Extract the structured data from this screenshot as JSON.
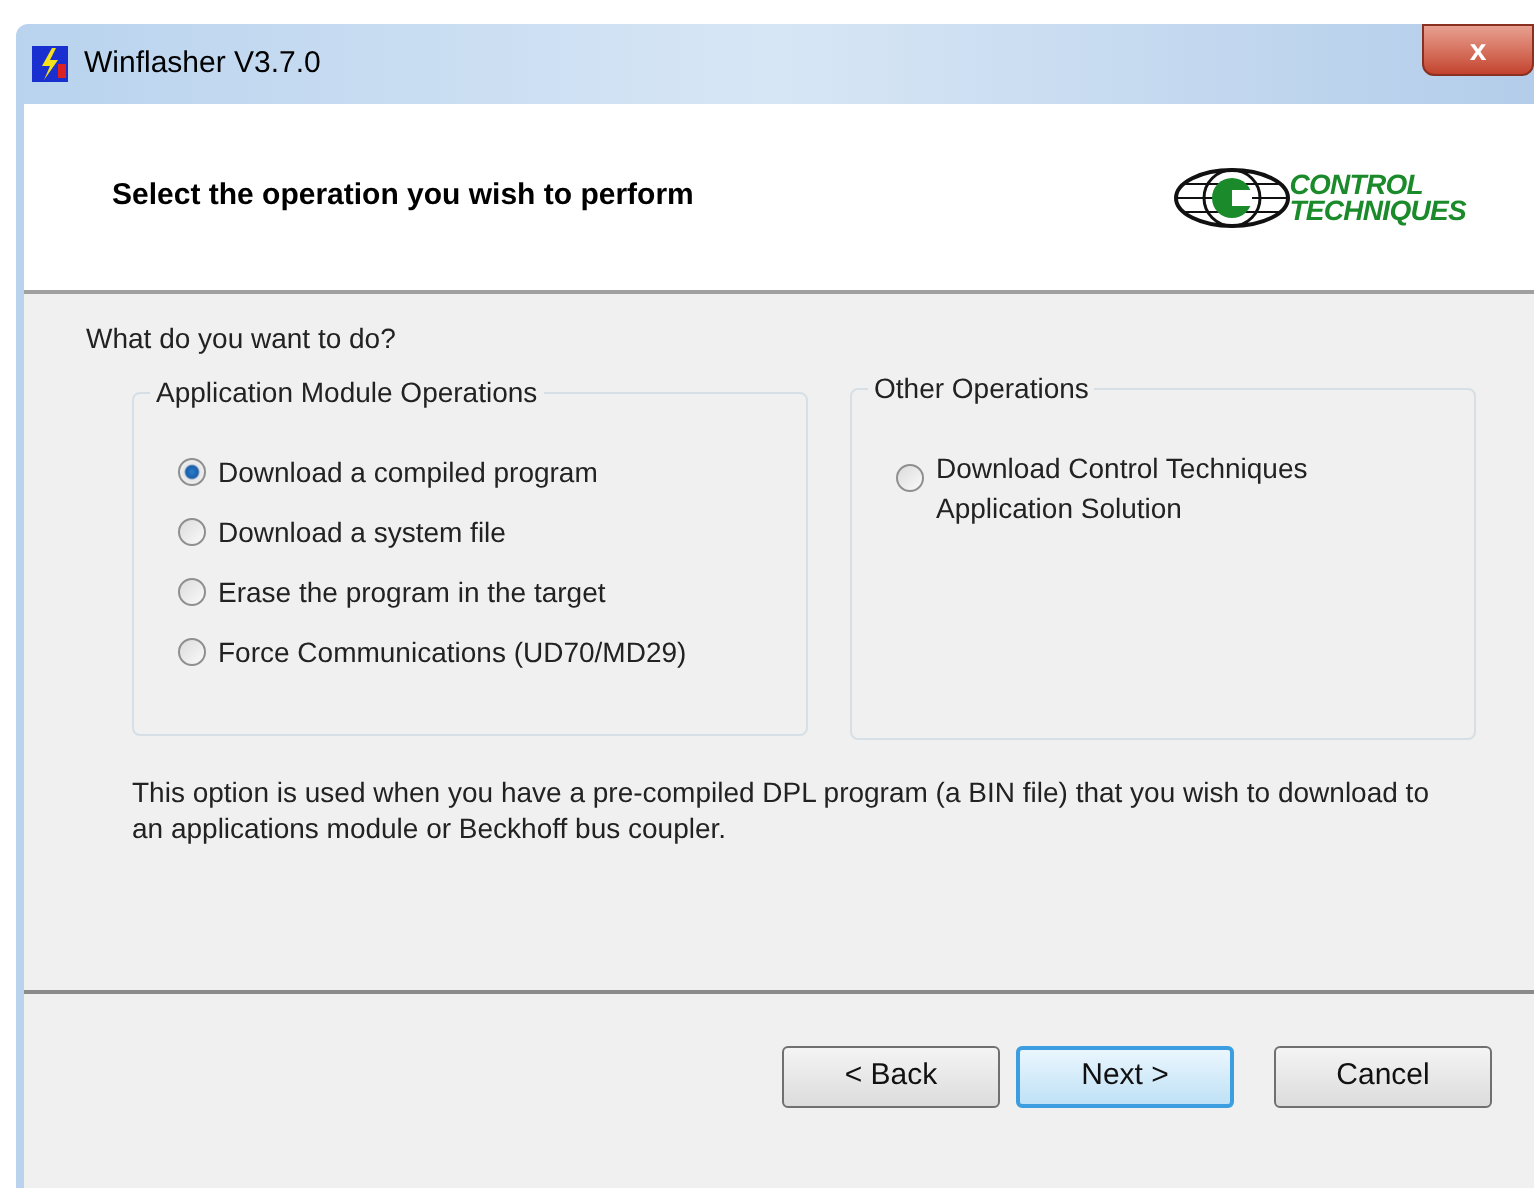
{
  "window": {
    "title": "Winflasher V3.7.0",
    "close": "x"
  },
  "header": {
    "title": "Select the operation you wish to perform",
    "logo_line_1": "CONTROL",
    "logo_line_2": "TECHNIQUES"
  },
  "question": "What do you want to do?",
  "groups": [
    {
      "title": "Application Module Operations",
      "options": [
        {
          "label": "Download a compiled program",
          "selected": true
        },
        {
          "label": "Download a system file",
          "selected": false
        },
        {
          "label": "Erase the program in the target",
          "selected": false
        },
        {
          "label": "Force Communications (UD70/MD29)",
          "selected": false
        }
      ]
    },
    {
      "title": "Other Operations",
      "options": [
        {
          "label": "Download Control Techniques Application Solution",
          "selected": false
        }
      ]
    }
  ],
  "description": "This option is used when you have a pre-compiled DPL program (a BIN file) that you wish to download to an applications module or Beckhoff bus coupler.",
  "buttons": [
    {
      "label": "< Back",
      "default": false
    },
    {
      "label": "Next >",
      "default": true
    },
    {
      "label": "Cancel",
      "default": false
    }
  ]
}
